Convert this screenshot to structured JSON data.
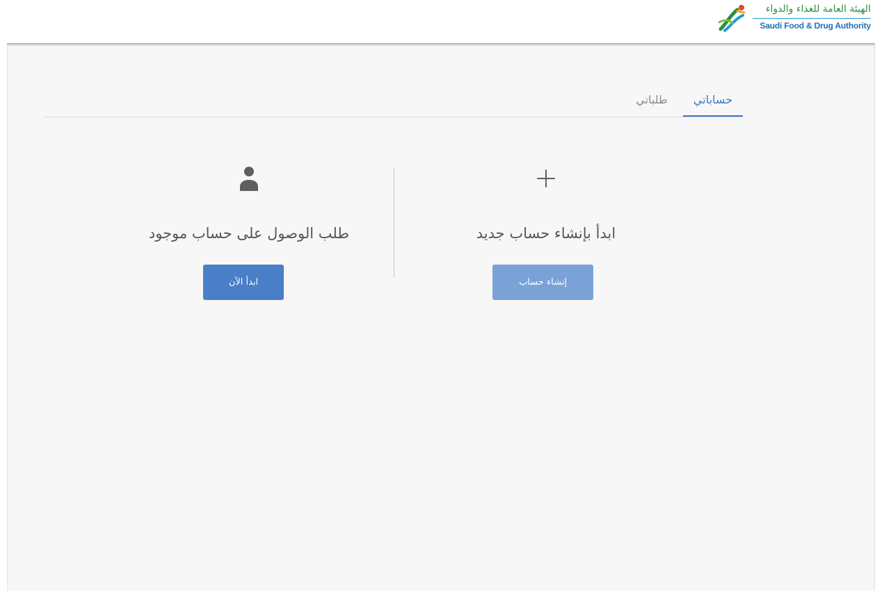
{
  "header": {
    "logo_ar": "الهيئة العامة للغذاء والدواء",
    "logo_en": "Saudi Food & Drug Authority",
    "logo_icon": "sfda-logo-icon"
  },
  "tabs": [
    {
      "label": "حساباتي",
      "active": true
    },
    {
      "label": "طلباتي",
      "active": false
    }
  ],
  "panels": {
    "existing": {
      "icon": "user-icon",
      "title": "طلب الوصول على حساب موجود",
      "button_label": "ابدأ الآن"
    },
    "create": {
      "icon": "plus-icon",
      "title": "ابدأ بإنشاء حساب جديد",
      "button_label": "إنشاء حساب"
    }
  },
  "colors": {
    "accent": "#3f74c8",
    "button_primary": "#4a7ec6",
    "button_secondary": "#7aa2d7",
    "logo_green": "#2b8f3c",
    "logo_blue": "#1f6db3"
  }
}
